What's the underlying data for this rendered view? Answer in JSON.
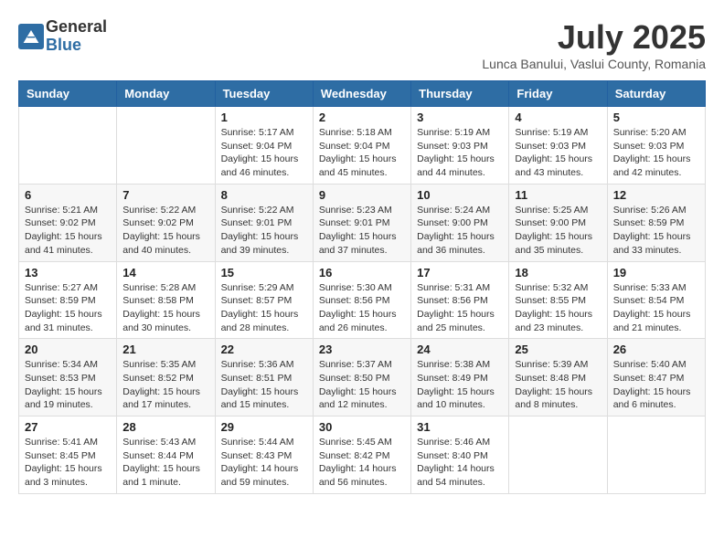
{
  "header": {
    "logo_general": "General",
    "logo_blue": "Blue",
    "month_title": "July 2025",
    "location": "Lunca Banului, Vaslui County, Romania"
  },
  "days_of_week": [
    "Sunday",
    "Monday",
    "Tuesday",
    "Wednesday",
    "Thursday",
    "Friday",
    "Saturday"
  ],
  "weeks": [
    [
      {
        "day": "",
        "info": ""
      },
      {
        "day": "",
        "info": ""
      },
      {
        "day": "1",
        "info": "Sunrise: 5:17 AM\nSunset: 9:04 PM\nDaylight: 15 hours and 46 minutes."
      },
      {
        "day": "2",
        "info": "Sunrise: 5:18 AM\nSunset: 9:04 PM\nDaylight: 15 hours and 45 minutes."
      },
      {
        "day": "3",
        "info": "Sunrise: 5:19 AM\nSunset: 9:03 PM\nDaylight: 15 hours and 44 minutes."
      },
      {
        "day": "4",
        "info": "Sunrise: 5:19 AM\nSunset: 9:03 PM\nDaylight: 15 hours and 43 minutes."
      },
      {
        "day": "5",
        "info": "Sunrise: 5:20 AM\nSunset: 9:03 PM\nDaylight: 15 hours and 42 minutes."
      }
    ],
    [
      {
        "day": "6",
        "info": "Sunrise: 5:21 AM\nSunset: 9:02 PM\nDaylight: 15 hours and 41 minutes."
      },
      {
        "day": "7",
        "info": "Sunrise: 5:22 AM\nSunset: 9:02 PM\nDaylight: 15 hours and 40 minutes."
      },
      {
        "day": "8",
        "info": "Sunrise: 5:22 AM\nSunset: 9:01 PM\nDaylight: 15 hours and 39 minutes."
      },
      {
        "day": "9",
        "info": "Sunrise: 5:23 AM\nSunset: 9:01 PM\nDaylight: 15 hours and 37 minutes."
      },
      {
        "day": "10",
        "info": "Sunrise: 5:24 AM\nSunset: 9:00 PM\nDaylight: 15 hours and 36 minutes."
      },
      {
        "day": "11",
        "info": "Sunrise: 5:25 AM\nSunset: 9:00 PM\nDaylight: 15 hours and 35 minutes."
      },
      {
        "day": "12",
        "info": "Sunrise: 5:26 AM\nSunset: 8:59 PM\nDaylight: 15 hours and 33 minutes."
      }
    ],
    [
      {
        "day": "13",
        "info": "Sunrise: 5:27 AM\nSunset: 8:59 PM\nDaylight: 15 hours and 31 minutes."
      },
      {
        "day": "14",
        "info": "Sunrise: 5:28 AM\nSunset: 8:58 PM\nDaylight: 15 hours and 30 minutes."
      },
      {
        "day": "15",
        "info": "Sunrise: 5:29 AM\nSunset: 8:57 PM\nDaylight: 15 hours and 28 minutes."
      },
      {
        "day": "16",
        "info": "Sunrise: 5:30 AM\nSunset: 8:56 PM\nDaylight: 15 hours and 26 minutes."
      },
      {
        "day": "17",
        "info": "Sunrise: 5:31 AM\nSunset: 8:56 PM\nDaylight: 15 hours and 25 minutes."
      },
      {
        "day": "18",
        "info": "Sunrise: 5:32 AM\nSunset: 8:55 PM\nDaylight: 15 hours and 23 minutes."
      },
      {
        "day": "19",
        "info": "Sunrise: 5:33 AM\nSunset: 8:54 PM\nDaylight: 15 hours and 21 minutes."
      }
    ],
    [
      {
        "day": "20",
        "info": "Sunrise: 5:34 AM\nSunset: 8:53 PM\nDaylight: 15 hours and 19 minutes."
      },
      {
        "day": "21",
        "info": "Sunrise: 5:35 AM\nSunset: 8:52 PM\nDaylight: 15 hours and 17 minutes."
      },
      {
        "day": "22",
        "info": "Sunrise: 5:36 AM\nSunset: 8:51 PM\nDaylight: 15 hours and 15 minutes."
      },
      {
        "day": "23",
        "info": "Sunrise: 5:37 AM\nSunset: 8:50 PM\nDaylight: 15 hours and 12 minutes."
      },
      {
        "day": "24",
        "info": "Sunrise: 5:38 AM\nSunset: 8:49 PM\nDaylight: 15 hours and 10 minutes."
      },
      {
        "day": "25",
        "info": "Sunrise: 5:39 AM\nSunset: 8:48 PM\nDaylight: 15 hours and 8 minutes."
      },
      {
        "day": "26",
        "info": "Sunrise: 5:40 AM\nSunset: 8:47 PM\nDaylight: 15 hours and 6 minutes."
      }
    ],
    [
      {
        "day": "27",
        "info": "Sunrise: 5:41 AM\nSunset: 8:45 PM\nDaylight: 15 hours and 3 minutes."
      },
      {
        "day": "28",
        "info": "Sunrise: 5:43 AM\nSunset: 8:44 PM\nDaylight: 15 hours and 1 minute."
      },
      {
        "day": "29",
        "info": "Sunrise: 5:44 AM\nSunset: 8:43 PM\nDaylight: 14 hours and 59 minutes."
      },
      {
        "day": "30",
        "info": "Sunrise: 5:45 AM\nSunset: 8:42 PM\nDaylight: 14 hours and 56 minutes."
      },
      {
        "day": "31",
        "info": "Sunrise: 5:46 AM\nSunset: 8:40 PM\nDaylight: 14 hours and 54 minutes."
      },
      {
        "day": "",
        "info": ""
      },
      {
        "day": "",
        "info": ""
      }
    ]
  ]
}
